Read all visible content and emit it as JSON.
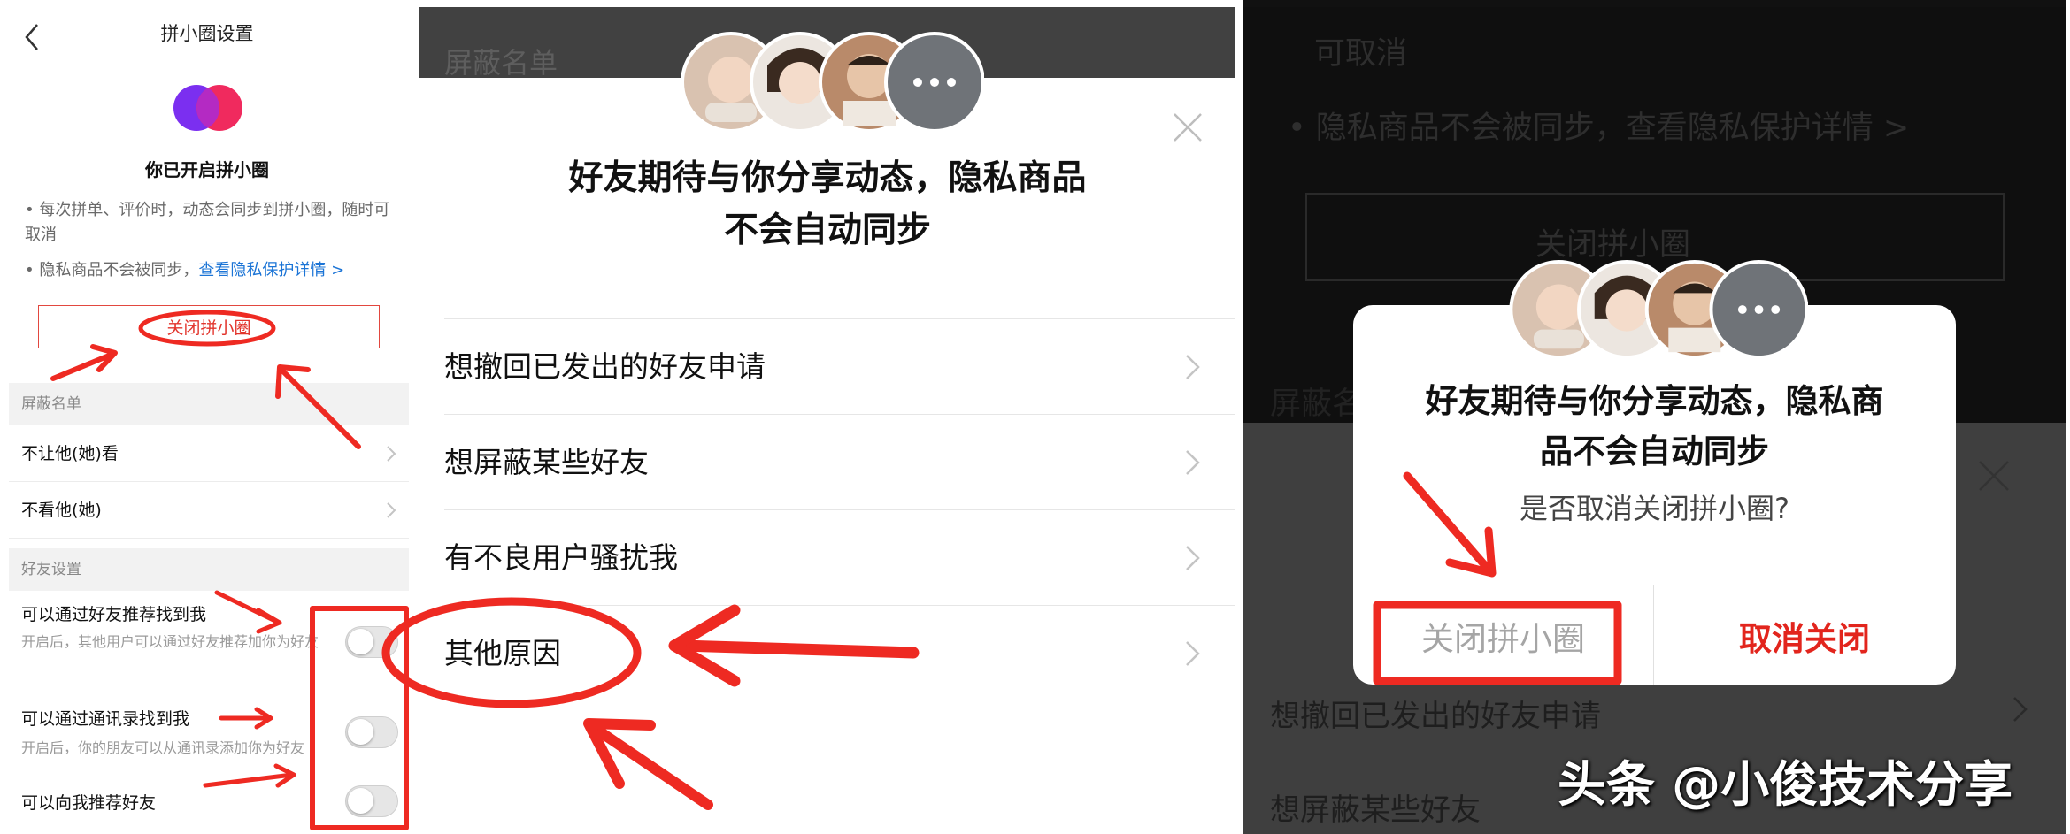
{
  "screen1": {
    "title": "拼小圈设置",
    "status_heading": "你已开启拼小圈",
    "bullet1": "• 每次拼单、评价时，动态会同步到拼小圈，随时可取消",
    "bullet2_text": "• 隐私商品不会被同步，",
    "bullet2_link": "查看隐私保护详情 >",
    "close_button": "关闭拼小圈",
    "block_section": "屏蔽名单",
    "block_items": [
      "不让他(她)看",
      "不看他(她)"
    ],
    "friend_section": "好友设置",
    "friend_settings": [
      {
        "title": "可以通过好友推荐找到我",
        "desc": "开启后，其他用户可以通过好友推荐加你为好友",
        "on": false
      },
      {
        "title": "可以通过通讯录找到我",
        "desc": "开启后，你的朋友可以从通讯录添加你为好友",
        "on": false
      },
      {
        "title": "可以向我推荐好友",
        "desc": "",
        "on": false
      }
    ]
  },
  "screen2": {
    "background_title": "屏蔽名单",
    "heading_line1": "好友期待与你分享动态，隐私商品",
    "heading_line2": "不会自动同步",
    "reasons": [
      "想撤回已发出的好友申请",
      "想屏蔽某些好友",
      "有不良用户骚扰我",
      "其他原因"
    ]
  },
  "screen3": {
    "background_lines": [
      "可取消",
      "• 隐私商品不会被同步，查看隐私保护详情 >",
      "关闭拼小圈",
      "屏蔽名单"
    ],
    "dialog_heading_line1": "好友期待与你分享动态，隐私商",
    "dialog_heading_line2": "品不会自动同步",
    "dialog_question": "是否取消关闭拼小圈?",
    "confirm_close_label": "关闭拼小圈",
    "cancel_close_label": "取消关闭",
    "below_items": [
      "想撤回已发出的好友申请",
      "想屏蔽某些好友"
    ]
  },
  "watermark": "头条 @小俊技术分享",
  "colors": {
    "accent_red": "#e2251d",
    "link_blue": "#1b74d6",
    "annotation_red": "#ee2a22"
  }
}
